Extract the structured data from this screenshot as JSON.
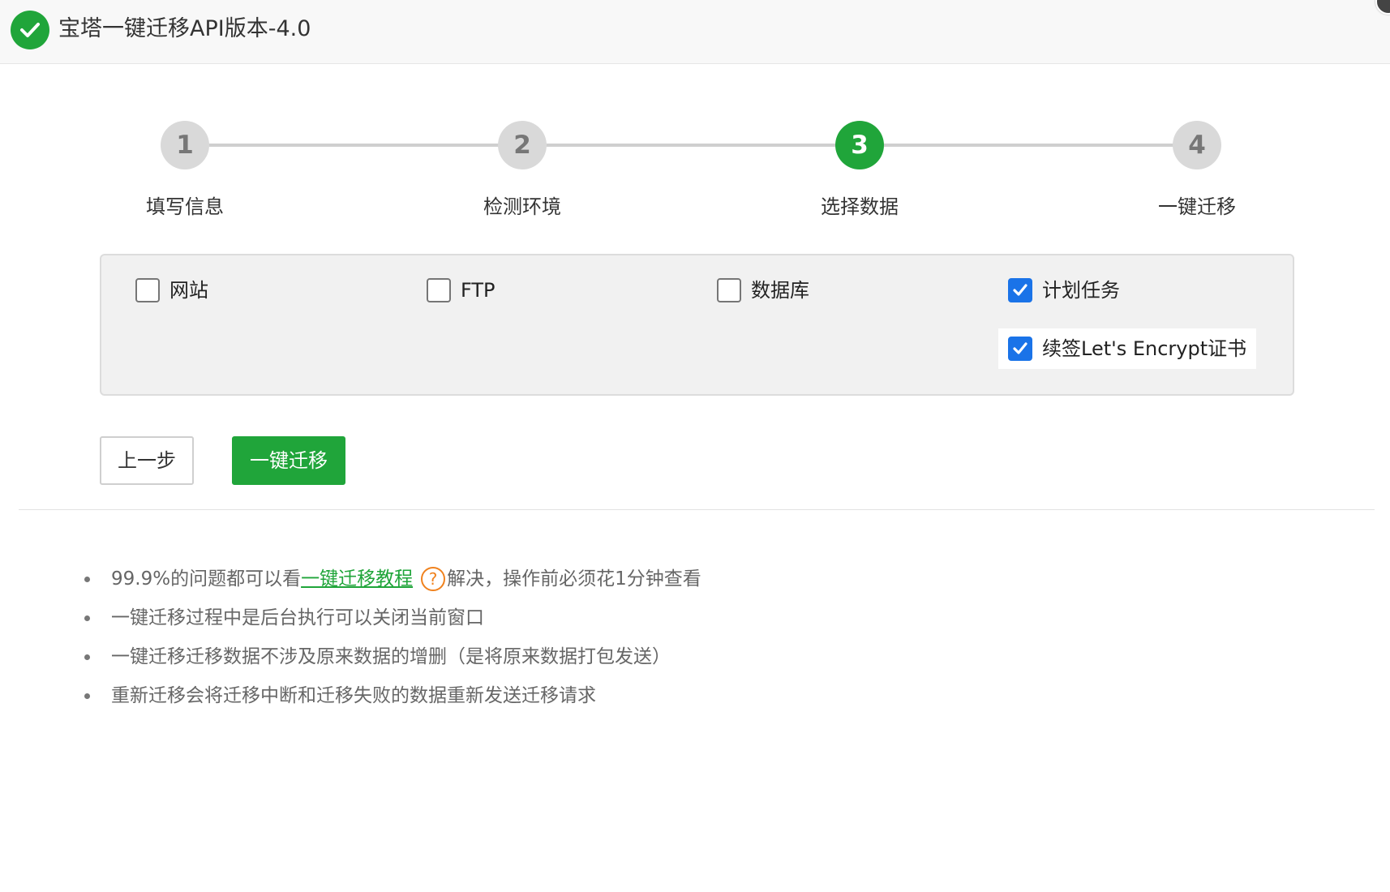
{
  "header": {
    "title": "宝塔一键迁移API版本-4.0"
  },
  "steps": [
    {
      "number": "1",
      "label": "填写信息",
      "active": false
    },
    {
      "number": "2",
      "label": "检测环境",
      "active": false
    },
    {
      "number": "3",
      "label": "选择数据",
      "active": true
    },
    {
      "number": "4",
      "label": "一键迁移",
      "active": false
    }
  ],
  "options": [
    {
      "label": "网站",
      "checked": false
    },
    {
      "label": "FTP",
      "checked": false
    },
    {
      "label": "数据库",
      "checked": false
    },
    {
      "label": "计划任务",
      "checked": true
    },
    {
      "label": "续签Let's Encrypt证书",
      "checked": true
    }
  ],
  "buttons": {
    "prev_label": "上一步",
    "migrate_label": "一键迁移"
  },
  "tips": {
    "tip1_prefix": "99.9%的问题都可以看",
    "tip1_link": "一键迁移教程",
    "tip1_help_glyph": "?",
    "tip1_suffix": "解决，操作前必须花1分钟查看",
    "tip2": "一键迁移过程中是后台执行可以关闭当前窗口",
    "tip3": "一键迁移迁移数据不涉及原来数据的增删（是将原来数据打包发送）",
    "tip4": "重新迁移会将迁移中断和迁移失败的数据重新发送迁移请求"
  },
  "colors": {
    "brand_green": "#20a53a",
    "checkbox_blue": "#1a73e8",
    "help_orange": "#f0821e"
  }
}
